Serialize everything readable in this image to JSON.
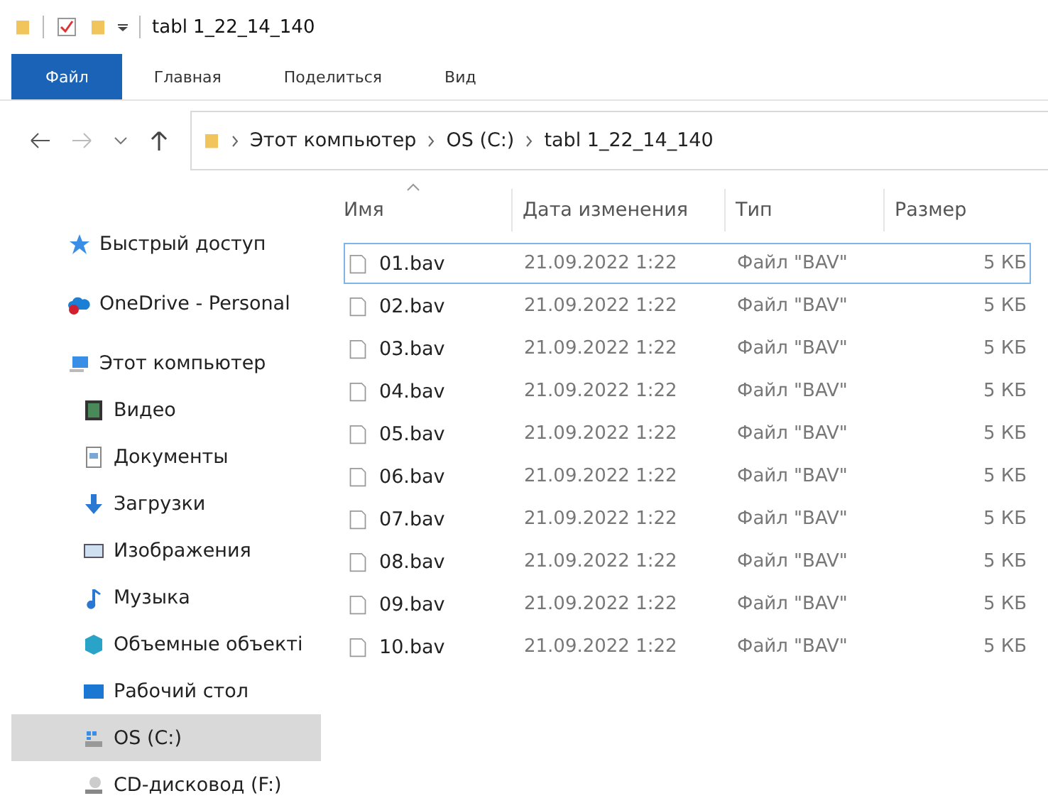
{
  "window": {
    "title": "tabl 1_22_14_140"
  },
  "ribbon_tabs": [
    {
      "label": "Файл",
      "selected": true
    },
    {
      "label": "Главная",
      "selected": false
    },
    {
      "label": "Поделиться",
      "selected": false
    },
    {
      "label": "Вид",
      "selected": false
    }
  ],
  "address": {
    "path": [
      {
        "label": "Этот компьютер"
      },
      {
        "label": "OS (C:)"
      },
      {
        "label": "tabl 1_22_14_140"
      }
    ]
  },
  "sidebar": {
    "items": [
      {
        "label": "Быстрый доступ",
        "kind": "star",
        "selected": false,
        "group": true
      },
      {
        "label": "OneDrive - Personal",
        "kind": "cloud",
        "selected": false,
        "group": true
      },
      {
        "label": "Этот компьютер",
        "kind": "computer",
        "selected": false,
        "group": true
      },
      {
        "label": "Видео",
        "kind": "video",
        "selected": false,
        "group": false
      },
      {
        "label": "Документы",
        "kind": "document",
        "selected": false,
        "group": false
      },
      {
        "label": "Загрузки",
        "kind": "download",
        "selected": false,
        "group": false
      },
      {
        "label": "Изображения",
        "kind": "image",
        "selected": false,
        "group": false
      },
      {
        "label": "Музыка",
        "kind": "music",
        "selected": false,
        "group": false
      },
      {
        "label": "Объемные объекті",
        "kind": "cube",
        "selected": false,
        "group": false
      },
      {
        "label": "Рабочий стол",
        "kind": "desktop",
        "selected": false,
        "group": false
      },
      {
        "label": "OS (C:)",
        "kind": "drive",
        "selected": true,
        "group": false
      },
      {
        "label": "CD-дисковод (F:)",
        "kind": "cd",
        "selected": false,
        "group": false
      }
    ]
  },
  "table": {
    "columns": [
      "Имя",
      "Дата изменения",
      "Тип",
      "Размер"
    ],
    "rows": [
      {
        "name": "01.bav",
        "date": "21.09.2022 1:22",
        "type": "Файл \"BAV\"",
        "size": "5 КБ",
        "focused": true
      },
      {
        "name": "02.bav",
        "date": "21.09.2022 1:22",
        "type": "Файл \"BAV\"",
        "size": "5 КБ",
        "focused": false
      },
      {
        "name": "03.bav",
        "date": "21.09.2022 1:22",
        "type": "Файл \"BAV\"",
        "size": "5 КБ",
        "focused": false
      },
      {
        "name": "04.bav",
        "date": "21.09.2022 1:22",
        "type": "Файл \"BAV\"",
        "size": "5 КБ",
        "focused": false
      },
      {
        "name": "05.bav",
        "date": "21.09.2022 1:22",
        "type": "Файл \"BAV\"",
        "size": "5 КБ",
        "focused": false
      },
      {
        "name": "06.bav",
        "date": "21.09.2022 1:22",
        "type": "Файл \"BAV\"",
        "size": "5 КБ",
        "focused": false
      },
      {
        "name": "07.bav",
        "date": "21.09.2022 1:22",
        "type": "Файл \"BAV\"",
        "size": "5 КБ",
        "focused": false
      },
      {
        "name": "08.bav",
        "date": "21.09.2022 1:22",
        "type": "Файл \"BAV\"",
        "size": "5 КБ",
        "focused": false
      },
      {
        "name": "09.bav",
        "date": "21.09.2022 1:22",
        "type": "Файл \"BAV\"",
        "size": "5 КБ",
        "focused": false
      },
      {
        "name": "10.bav",
        "date": "21.09.2022 1:22",
        "type": "Файл \"BAV\"",
        "size": "5 КБ",
        "focused": false
      }
    ]
  }
}
